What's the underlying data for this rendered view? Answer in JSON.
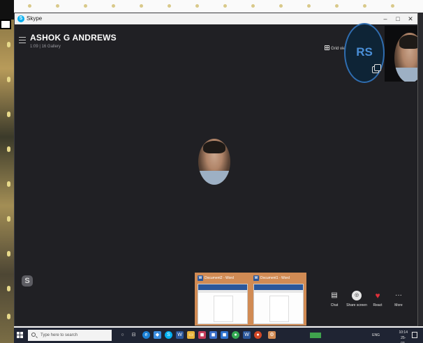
{
  "window": {
    "app_title": "Skype",
    "controls": {
      "minimize": "–",
      "maximize": "□",
      "close": "✕"
    }
  },
  "call": {
    "caller_name": "ASHOK G ANDREWS",
    "subinfo": "1:09 | 16 Gallery",
    "grid_view_label": "Grid view",
    "participant_initials": "RS",
    "skype_badge": "S"
  },
  "thumbnails": [
    {
      "title": "Document2 - Word"
    },
    {
      "title": "Document1 - Word"
    }
  ],
  "controls": [
    {
      "label": "Chat",
      "icon": "chat-icon",
      "glyph": "▤"
    },
    {
      "label": "Share screen",
      "icon": "share-screen-icon",
      "glyph": "◎"
    },
    {
      "label": "React",
      "icon": "heart-icon",
      "glyph": "♥"
    },
    {
      "label": "More",
      "icon": "more-icon",
      "glyph": "···"
    }
  ],
  "taskbar": {
    "search_placeholder": "Type here to search",
    "language": "ENG",
    "time": "10:14",
    "date": "25-03-2021"
  },
  "colors": {
    "window_bg": "#202024",
    "accent": "#2f6db0",
    "thumbnail_border": "#d18b54",
    "taskbar": "#1f2433"
  }
}
